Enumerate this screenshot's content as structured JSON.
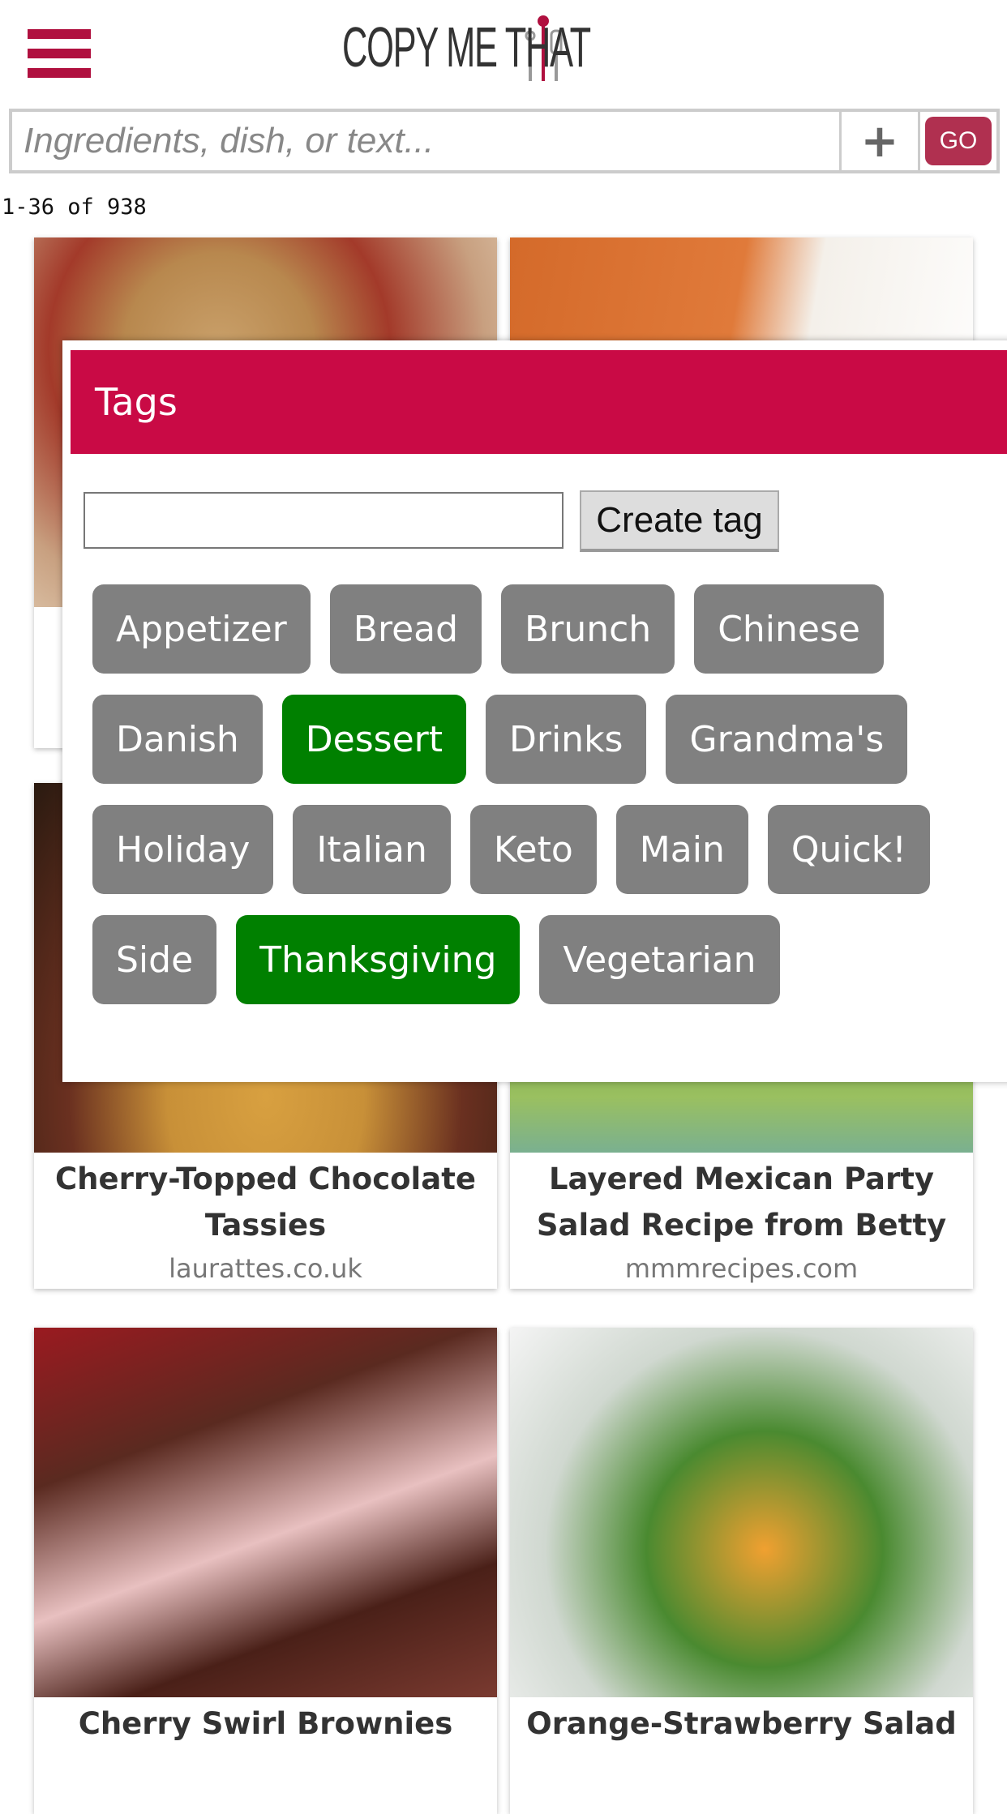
{
  "header": {
    "logo_text": "COPY ME THAT",
    "menu_icon": "hamburger-icon"
  },
  "search": {
    "placeholder": "Ingredients, dish, or text...",
    "value": "",
    "add_label": "+",
    "go_label": "GO"
  },
  "results": {
    "count": "1-36 of 938"
  },
  "recipes": [
    {
      "title": "",
      "source": ""
    },
    {
      "title": "",
      "source": ""
    },
    {
      "title": "Cherry-Topped Chocolate Tassies",
      "source": "laurattes.co.uk"
    },
    {
      "title": "Layered Mexican Party Salad Recipe from Betty",
      "source": "mmmrecipes.com"
    },
    {
      "title": "Cherry Swirl Brownies",
      "source": ""
    },
    {
      "title": "Orange-Strawberry Salad",
      "source": ""
    }
  ],
  "tags_modal": {
    "title": "Tags",
    "input_value": "",
    "create_label": "Create tag",
    "tags": [
      {
        "label": "Appetizer",
        "selected": false
      },
      {
        "label": "Bread",
        "selected": false
      },
      {
        "label": "Brunch",
        "selected": false
      },
      {
        "label": "Chinese",
        "selected": false
      },
      {
        "label": "Danish",
        "selected": false
      },
      {
        "label": "Dessert",
        "selected": true
      },
      {
        "label": "Drinks",
        "selected": false
      },
      {
        "label": "Grandma's",
        "selected": false
      },
      {
        "label": "Holiday",
        "selected": false
      },
      {
        "label": "Italian",
        "selected": false
      },
      {
        "label": "Keto",
        "selected": false
      },
      {
        "label": "Main",
        "selected": false
      },
      {
        "label": "Quick!",
        "selected": false
      },
      {
        "label": "Side",
        "selected": false
      },
      {
        "label": "Thanksgiving",
        "selected": true
      },
      {
        "label": "Vegetarian",
        "selected": false
      }
    ]
  },
  "colors": {
    "brand": "#c90a45",
    "selected_tag": "#008000",
    "tag": "#808080",
    "go": "#b03050"
  }
}
